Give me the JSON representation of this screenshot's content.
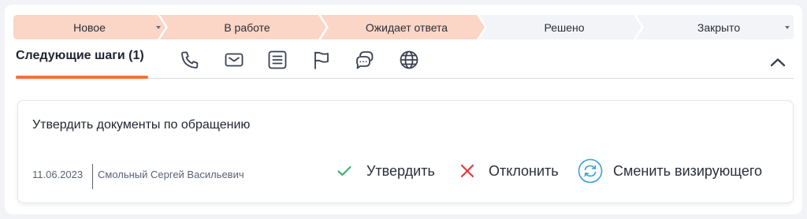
{
  "pipeline": {
    "stages": [
      {
        "label": "Новое",
        "has_dropdown": true,
        "state": "done"
      },
      {
        "label": "В работе",
        "has_dropdown": false,
        "state": "done"
      },
      {
        "label": "Ожидает ответа",
        "has_dropdown": false,
        "state": "current"
      },
      {
        "label": "Решено",
        "has_dropdown": false,
        "state": "pending"
      },
      {
        "label": "Закрыто",
        "has_dropdown": true,
        "state": "pending"
      }
    ],
    "done_color": "#fbd5c5",
    "pending_color": "#f3f4f7"
  },
  "tabs": {
    "active_label": "Следующие шаги (1)",
    "accent_color": "#f07534",
    "icons": [
      "phone-icon",
      "mail-icon",
      "document-icon",
      "flag-icon",
      "chat-icon",
      "globe-icon"
    ]
  },
  "task": {
    "title": "Утвердить документы по обращению",
    "date": "11.06.2023",
    "author": "Смольный Сергей Васильевич",
    "approve_label": "Утвердить",
    "reject_label": "Отклонить",
    "change_label": "Сменить визирующего",
    "approve_color": "#3cb371",
    "reject_color": "#e23b3b",
    "change_color": "#3aa0dc"
  }
}
